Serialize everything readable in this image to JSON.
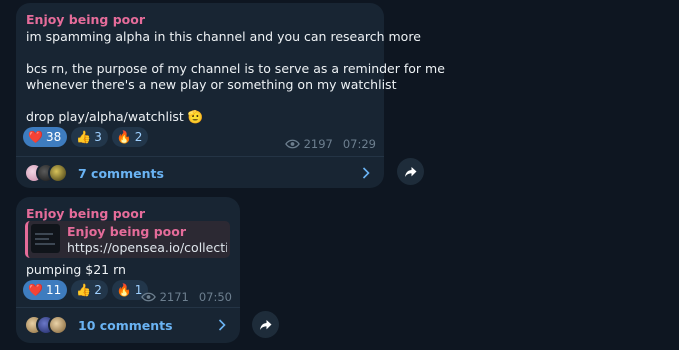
{
  "messages": [
    {
      "sender": "Enjoy being poor",
      "lines": [
        "im spamming alpha in this channel and you can research more",
        "bcs rn, the purpose of my channel is to serve as a reminder for me",
        "whenever there's a new play or something on my watchlist",
        "drop play/alpha/watchlist 🫡"
      ],
      "reactions": [
        {
          "emoji": "❤️",
          "count": "38",
          "selected": true
        },
        {
          "emoji": "👍",
          "count": "3",
          "selected": false
        },
        {
          "emoji": "🔥",
          "count": "2",
          "selected": false
        }
      ],
      "views": "2197",
      "time": "07:29",
      "comments": "7 comments"
    },
    {
      "sender": "Enjoy being poor",
      "quote": {
        "title": "Enjoy being poor",
        "link": "https://opensea.io/collectio..."
      },
      "lines": [
        "pumping $21 rn"
      ],
      "reactions": [
        {
          "emoji": "❤️",
          "count": "11",
          "selected": true
        },
        {
          "emoji": "👍",
          "count": "2",
          "selected": false
        },
        {
          "emoji": "🔥",
          "count": "1",
          "selected": false
        }
      ],
      "views": "2171",
      "time": "07:50",
      "comments": "10 comments"
    }
  ],
  "icons": {
    "views": "eye-icon",
    "share": "share-arrow-icon",
    "chevron": "chevron-right-icon"
  },
  "colors": {
    "background": "#0e1621",
    "bubble": "#182533",
    "sender": "#e56c9a",
    "link": "#6ab3f3",
    "reaction_selected": "#3e7cbf"
  }
}
